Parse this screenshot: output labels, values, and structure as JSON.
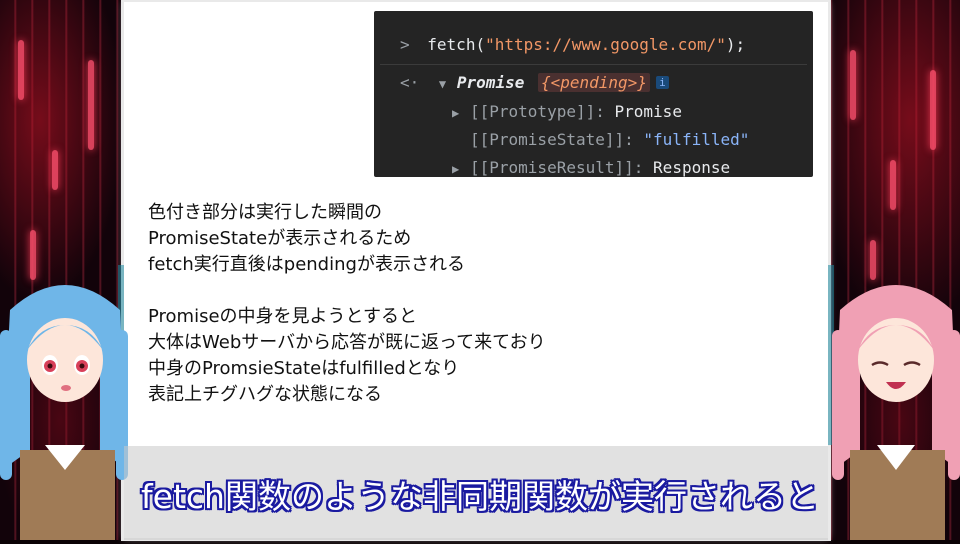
{
  "console": {
    "line1_prompt": ">",
    "line1_code_prefix": "fetch(",
    "line1_string": "\"https://www.google.com/\"",
    "line1_code_suffix": ");",
    "line2_prompt": "<·",
    "line2_type": "Promise",
    "line2_state": "{<pending>}",
    "info_icon_label": "i",
    "prop1_name": "[[Prototype]]",
    "prop1_value": "Promise",
    "prop2_name": "[[PromiseState]]",
    "prop2_value": "\"fulfilled\"",
    "prop3_name": "[[PromiseResult]]",
    "prop3_value": "Response",
    "colon": ":"
  },
  "body": {
    "lines_a": [
      "色付き部分は実行した瞬間の",
      "PromiseStateが表示されるため",
      "fetch実行直後はpendingが表示される"
    ],
    "lines_b": [
      "Promiseの中身を見ようとすると",
      "大体はWebサーバから応答が既に返って来ており",
      "中身のPromsieStateはfulfilledとなり",
      "表記上チグハグな状態になる"
    ]
  },
  "subtitle": "fetch関数のような非同期関数が実行されると",
  "colors": {
    "slide_bg": "#ffffff",
    "console_bg": "#242424",
    "string_orange": "#f29766",
    "subtitle_outline": "#1a1aa0"
  }
}
